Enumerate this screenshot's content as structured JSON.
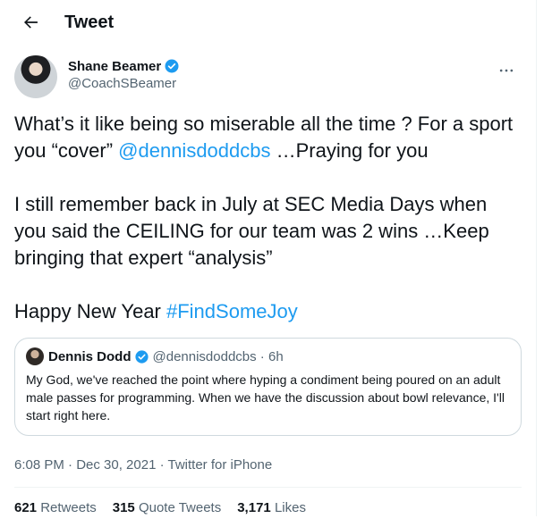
{
  "header": {
    "title": "Tweet"
  },
  "tweet": {
    "author": {
      "name": "Shane Beamer",
      "handle": "@CoachSBeamer"
    },
    "text": {
      "p1_a": "What’s it like being so miserable all the time ? For a sport you “cover” ",
      "p1_mention": "@dennisdoddcbs",
      "p1_b": " …Praying for you",
      "p2": "I still remember back in July at SEC Media Days when you said the CEILING for our team was 2 wins …Keep bringing that expert “analysis”",
      "p3_a": "Happy New Year ",
      "p3_hashtag": "#FindSomeJoy"
    },
    "quoted": {
      "name": "Dennis Dodd",
      "meta": "@dennisdoddcbs · 6h",
      "text": "My God, we've reached the point where hyping a condiment being poured on an adult male passes for programming. When we have the discussion about bowl relevance, I'll start right here."
    },
    "timestamp": "6:08 PM · Dec 30, 2021 · Twitter for iPhone",
    "stats": {
      "retweets_count": "621",
      "retweets_label": "Retweets",
      "quotes_count": "315",
      "quotes_label": "Quote Tweets",
      "likes_count": "3,171",
      "likes_label": "Likes"
    }
  },
  "icons": {
    "back": "arrow-left-icon",
    "verified": "verified-badge-icon",
    "more": "more-horizontal-icon"
  },
  "colors": {
    "accent": "#1d9bf0",
    "text": "#0f1419",
    "secondary": "#536471",
    "border": "#cfd9de"
  }
}
